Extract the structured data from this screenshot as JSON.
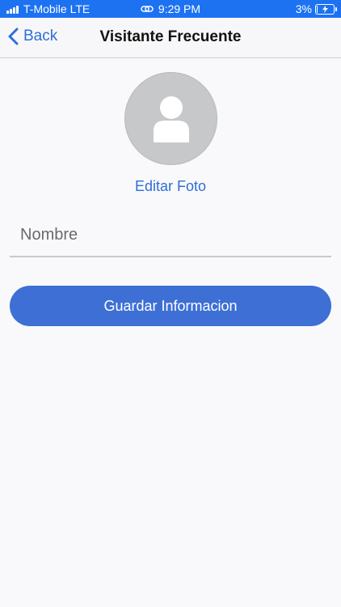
{
  "status_bar": {
    "carrier": "T-Mobile LTE",
    "time": "9:29 PM",
    "battery_percent": "3%",
    "battery_level": 0.03,
    "background": "#1d72f2",
    "icons": [
      "signal-icon",
      "link-icon",
      "battery-icon",
      "bolt-icon"
    ]
  },
  "nav": {
    "back_label": "Back",
    "title": "Visitante Frecuente",
    "accent": "#2f6ed9",
    "icons": [
      "chevron-left-icon"
    ]
  },
  "profile": {
    "edit_photo_label": "Editar Foto",
    "avatar_icon": "person-icon"
  },
  "form": {
    "name_placeholder": "Nombre",
    "name_value": "",
    "save_label": "Guardar Informacion",
    "save_color": "#3d6fd5"
  }
}
